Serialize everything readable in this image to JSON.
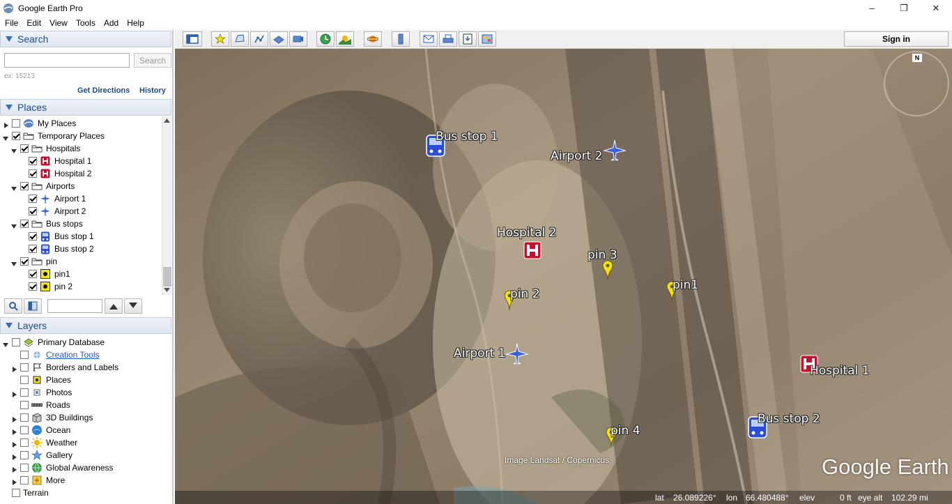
{
  "window": {
    "title": "Google Earth Pro",
    "minimize": "–",
    "restore": "❐",
    "close": "✕"
  },
  "menu": [
    "File",
    "Edit",
    "View",
    "Tools",
    "Add",
    "Help"
  ],
  "search": {
    "header": "Search",
    "input_value": "",
    "button_label": "Search",
    "hint": "ex: 15213",
    "get_directions": "Get Directions",
    "history": "History"
  },
  "places": {
    "header": "Places",
    "items": [
      {
        "label": "My Places",
        "level": 0,
        "expander": "closed",
        "checked": false,
        "icon": "my-places-icon"
      },
      {
        "label": "Temporary Places",
        "level": 0,
        "expander": "open",
        "checked": true,
        "icon": "folder-icon"
      },
      {
        "label": "Hospitals",
        "level": 1,
        "expander": "open",
        "checked": true,
        "icon": "folder-icon"
      },
      {
        "label": "Hospital 1",
        "level": 2,
        "expander": "none",
        "checked": true,
        "icon": "hospital-icon"
      },
      {
        "label": "Hospital 2",
        "level": 2,
        "expander": "none",
        "checked": true,
        "icon": "hospital-icon"
      },
      {
        "label": "Airports",
        "level": 1,
        "expander": "open",
        "checked": true,
        "icon": "folder-icon"
      },
      {
        "label": "Airport 1",
        "level": 2,
        "expander": "none",
        "checked": true,
        "icon": "airplane-icon"
      },
      {
        "label": "Airport 2",
        "level": 2,
        "expander": "none",
        "checked": true,
        "icon": "airplane-icon"
      },
      {
        "label": "Bus stops",
        "level": 1,
        "expander": "open",
        "checked": true,
        "icon": "folder-icon"
      },
      {
        "label": "Bus stop 1",
        "level": 2,
        "expander": "none",
        "checked": true,
        "icon": "bus-icon"
      },
      {
        "label": "Bus stop 2",
        "level": 2,
        "expander": "none",
        "checked": true,
        "icon": "bus-icon"
      },
      {
        "label": "pin",
        "level": 1,
        "expander": "open",
        "checked": true,
        "icon": "folder-icon"
      },
      {
        "label": "pin1",
        "level": 2,
        "expander": "none",
        "checked": true,
        "icon": "pin-icon"
      },
      {
        "label": "pin 2",
        "level": 2,
        "expander": "none",
        "checked": true,
        "icon": "pin-icon"
      }
    ],
    "filter_value": ""
  },
  "layers": {
    "header": "Layers",
    "items": [
      {
        "label": "Primary Database",
        "level": 0,
        "expander": "open",
        "checked": false,
        "icon": "database-icon"
      },
      {
        "label": "Creation Tools",
        "level": 1,
        "expander": "none",
        "checked": false,
        "icon": "creation-tools-icon",
        "link": true
      },
      {
        "label": "Borders and Labels",
        "level": 1,
        "expander": "closed",
        "checked": false,
        "icon": "borders-icon"
      },
      {
        "label": "Places",
        "level": 1,
        "expander": "none",
        "checked": false,
        "icon": "places-layer-icon"
      },
      {
        "label": "Photos",
        "level": 1,
        "expander": "closed",
        "checked": false,
        "icon": "photos-icon"
      },
      {
        "label": "Roads",
        "level": 1,
        "expander": "none",
        "checked": false,
        "icon": "roads-icon"
      },
      {
        "label": "3D Buildings",
        "level": 1,
        "expander": "closed",
        "checked": false,
        "icon": "buildings-icon"
      },
      {
        "label": "Ocean",
        "level": 1,
        "expander": "closed",
        "checked": false,
        "icon": "ocean-icon"
      },
      {
        "label": "Weather",
        "level": 1,
        "expander": "closed",
        "checked": false,
        "icon": "weather-icon"
      },
      {
        "label": "Gallery",
        "level": 1,
        "expander": "closed",
        "checked": false,
        "icon": "gallery-icon"
      },
      {
        "label": "Global Awareness",
        "level": 1,
        "expander": "closed",
        "checked": false,
        "icon": "globe-icon"
      },
      {
        "label": "More",
        "level": 1,
        "expander": "closed",
        "checked": false,
        "icon": "more-icon"
      },
      {
        "label": "Terrain",
        "level": 0,
        "expander": "none",
        "checked": false,
        "icon": "none"
      }
    ]
  },
  "toolbar": {
    "sign_in": "Sign in"
  },
  "map": {
    "placemarks": [
      {
        "label": "Bus stop 1",
        "type": "bus"
      },
      {
        "label": "Airport 2",
        "type": "airplane"
      },
      {
        "label": "Hospital 2",
        "type": "hospital"
      },
      {
        "label": "pin 3",
        "type": "pin"
      },
      {
        "label": "pin1",
        "type": "pin"
      },
      {
        "label": "pin 2",
        "type": "pin"
      },
      {
        "label": "Airport 1",
        "type": "airplane"
      },
      {
        "label": "Hospital 1",
        "type": "hospital"
      },
      {
        "label": "pin 4",
        "type": "pin"
      },
      {
        "label": "Bus stop 2",
        "type": "bus"
      }
    ],
    "attribution": "Image Landsat / Copernicus",
    "logo": "Google Earth",
    "compass_label": "N",
    "status": {
      "lat_label": "lat",
      "lat_value": "26.089226°",
      "lon_label": "lon",
      "lon_value": "66.480488°",
      "elev_label": "elev",
      "elev_value": "0 ft",
      "eye_label": "eye alt",
      "eye_value": "102.29 mi"
    }
  },
  "colors": {
    "header_text": "#1e4a86",
    "hospital": "#c8102e",
    "bus": "#2a4fd6",
    "airplane": "#3b62d8",
    "pin": "#f2e21a"
  }
}
